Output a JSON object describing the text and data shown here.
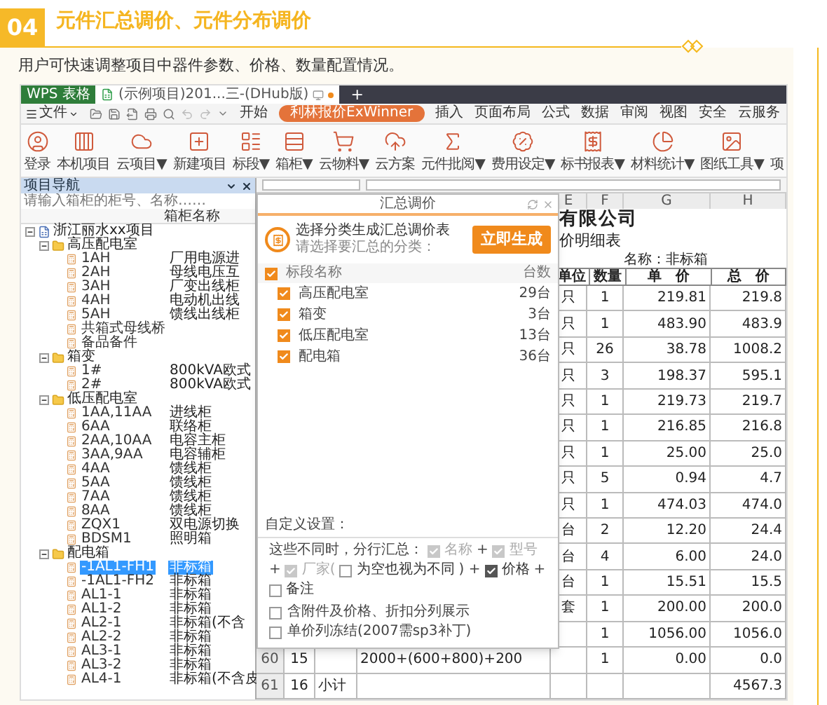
{
  "section": {
    "number": "04",
    "title": "元件汇总调价、元件分布调价",
    "description": "用户可快速调整项目中器件参数、价格、数量配置情况。"
  },
  "app": {
    "tabs": [
      {
        "label": "WPS 表格",
        "kind": "app",
        "selected": false
      },
      {
        "label": "(示例项目)201...三-(DHub版)",
        "kind": "doc",
        "selected": true
      }
    ],
    "new_tab": "+",
    "file_menu": "文件",
    "menu": [
      {
        "label": "开始",
        "selected": false
      },
      {
        "label": "利林报价ExWinner",
        "selected": true
      },
      {
        "label": "插入",
        "selected": false
      },
      {
        "label": "页面布局",
        "selected": false
      },
      {
        "label": "公式",
        "selected": false
      },
      {
        "label": "数据",
        "selected": false
      },
      {
        "label": "审阅",
        "selected": false
      },
      {
        "label": "视图",
        "selected": false
      },
      {
        "label": "安全",
        "selected": false
      },
      {
        "label": "云服务",
        "selected": false
      }
    ],
    "ribbon": [
      "登录",
      "本机项目",
      "云项目▼",
      "新建项目",
      "标段▼",
      "箱柜▼",
      "云物料▼",
      "云方案",
      "元件批阅▼",
      "费用设定▼",
      "标书报表▼",
      "材料统计▼",
      "图纸工具▼",
      "项"
    ]
  },
  "navigator": {
    "title": "项目导航",
    "search_placeholder": "请输入箱柜的柜号、名称……",
    "column": "箱柜名称",
    "tree": [
      {
        "name": "浙江丽水xx项目",
        "expanded": true,
        "children": [
          {
            "name": "高压配电室",
            "expanded": true,
            "children": [
              {
                "name": "1AH",
                "box": "厂用电源进",
                "selected": false
              },
              {
                "name": "2AH",
                "box": "母线电压互",
                "selected": false
              },
              {
                "name": "3AH",
                "box": "厂变出线柜",
                "selected": false
              },
              {
                "name": "4AH",
                "box": "电动机出线",
                "selected": false
              },
              {
                "name": "5AH",
                "box": "馈线出线柜",
                "selected": false
              },
              {
                "name": "共箱式母线桥",
                "selected": false
              },
              {
                "name": "备品备件",
                "selected": false
              }
            ]
          },
          {
            "name": "箱变",
            "expanded": true,
            "children": [
              {
                "name": "1#",
                "box": "800kVA欧式",
                "selected": false
              },
              {
                "name": "2#",
                "box": "800kVA欧式",
                "selected": false
              }
            ]
          },
          {
            "name": "低压配电室",
            "expanded": true,
            "children": [
              {
                "name": "1AA,11AA",
                "box": "进线柜",
                "selected": false
              },
              {
                "name": "6AA",
                "box": "联络柜",
                "selected": false
              },
              {
                "name": "2AA,10AA",
                "box": "电容主柜",
                "selected": false
              },
              {
                "name": "3AA,9AA",
                "box": "电容辅柜",
                "selected": false
              },
              {
                "name": "4AA",
                "box": "馈线柜",
                "selected": false
              },
              {
                "name": "5AA",
                "box": "馈线柜",
                "selected": false
              },
              {
                "name": "7AA",
                "box": "馈线柜",
                "selected": false
              },
              {
                "name": "8AA",
                "box": "馈线柜",
                "selected": false
              },
              {
                "name": "ZQX1",
                "box": "双电源切换",
                "selected": false
              },
              {
                "name": "BDSM1",
                "box": "照明箱",
                "selected": false
              }
            ]
          },
          {
            "name": "配电箱",
            "expanded": true,
            "children": [
              {
                "name": "-1AL1-FH1",
                "box": "非标箱",
                "selected": true
              },
              {
                "name": "-1AL1-FH2",
                "box": "非标箱",
                "selected": false
              },
              {
                "name": "AL1-1",
                "box": "非标箱",
                "selected": false
              },
              {
                "name": "AL1-2",
                "box": "非标箱",
                "selected": false
              },
              {
                "name": "AL2-1",
                "box": "非标箱(不含",
                "selected": false
              },
              {
                "name": "AL2-2",
                "box": "非标箱",
                "selected": false
              },
              {
                "name": "AL3-1",
                "box": "非标箱",
                "selected": false
              },
              {
                "name": "AL3-2",
                "box": "非标箱",
                "selected": false
              },
              {
                "name": "AL4-1",
                "box": "非标箱(不含皮",
                "selected": false
              }
            ]
          }
        ]
      }
    ]
  },
  "sheet": {
    "columns": [
      "E",
      "F",
      "G",
      "H"
    ],
    "company": "有限公司",
    "subtitle": "价明细表",
    "name_line": "名称：非标箱",
    "headers": [
      "单位",
      "数量",
      "单　价",
      "总　价"
    ],
    "rows": [
      {
        "unit": "只",
        "qty": "1",
        "price": "219.81",
        "total": "219.8"
      },
      {
        "unit": "只",
        "qty": "1",
        "price": "483.90",
        "total": "483.9"
      },
      {
        "unit": "只",
        "qty": "26",
        "price": "38.78",
        "total": "1008.2"
      },
      {
        "unit": "只",
        "qty": "3",
        "price": "198.37",
        "total": "595.1"
      },
      {
        "unit": "只",
        "qty": "1",
        "price": "219.73",
        "total": "219.7"
      },
      {
        "unit": "只",
        "qty": "1",
        "price": "216.85",
        "total": "216.8"
      },
      {
        "unit": "只",
        "qty": "1",
        "price": "25.00",
        "total": "25.0"
      },
      {
        "unit": "只",
        "qty": "5",
        "price": "0.94",
        "total": "4.7"
      },
      {
        "unit": "只",
        "qty": "1",
        "price": "474.03",
        "total": "474.0"
      },
      {
        "unit": "台",
        "qty": "2",
        "price": "12.20",
        "total": "24.4"
      },
      {
        "unit": "台",
        "qty": "4",
        "price": "6.00",
        "total": "24.0"
      },
      {
        "unit": "台",
        "qty": "1",
        "price": "15.51",
        "total": "15.5"
      },
      {
        "unit": "套",
        "qty": "1",
        "price": "200.00",
        "total": "200.0"
      },
      {
        "qty": "1",
        "price": "1056.00",
        "total": "1056.0"
      },
      {
        "row_number": "60",
        "col_b": "15",
        "col_d": "2000+(600+800)+200",
        "qty": "1",
        "price": "0.00",
        "total": "0.0"
      },
      {
        "row_number": "61",
        "col_b": "16",
        "col_c": "小计",
        "total": "4567.3"
      }
    ]
  },
  "dialog": {
    "title": "汇总调价",
    "heading": "选择分类生成汇总调价表",
    "hint": "请选择要汇总的分类：",
    "generate_button": "立即生成",
    "header": {
      "label": "标段名称",
      "count": "台数",
      "checked": true
    },
    "items": [
      {
        "name": "高压配电室",
        "count": "29台",
        "checked": true
      },
      {
        "name": "箱变",
        "count": "3台",
        "checked": true
      },
      {
        "name": "低压配电室",
        "count": "13台",
        "checked": true
      },
      {
        "name": "配电箱",
        "count": "36台",
        "checked": true
      }
    ],
    "custom_label": "自定义设置：",
    "split_label": "这些不同时，分行汇总：",
    "split_options": [
      {
        "label": "名称",
        "checked": true,
        "disabled": true,
        "after": "+"
      },
      {
        "label": "型号",
        "checked": true,
        "disabled": true,
        "after": "+"
      },
      {
        "label": "厂家(",
        "checked": true,
        "disabled": true
      },
      {
        "label": "为空也视为不同",
        "checked": false,
        "disabled": false,
        "after": ") +"
      },
      {
        "label": "价格",
        "checked": true,
        "disabled": false,
        "after": "+"
      },
      {
        "label": "备注",
        "checked": false,
        "disabled": false
      }
    ],
    "bottom_options": [
      {
        "label": "含附件及价格、折扣分列展示",
        "checked": false
      },
      {
        "label": "单价列冻结(2007需sp3补丁)",
        "checked": false
      }
    ]
  }
}
